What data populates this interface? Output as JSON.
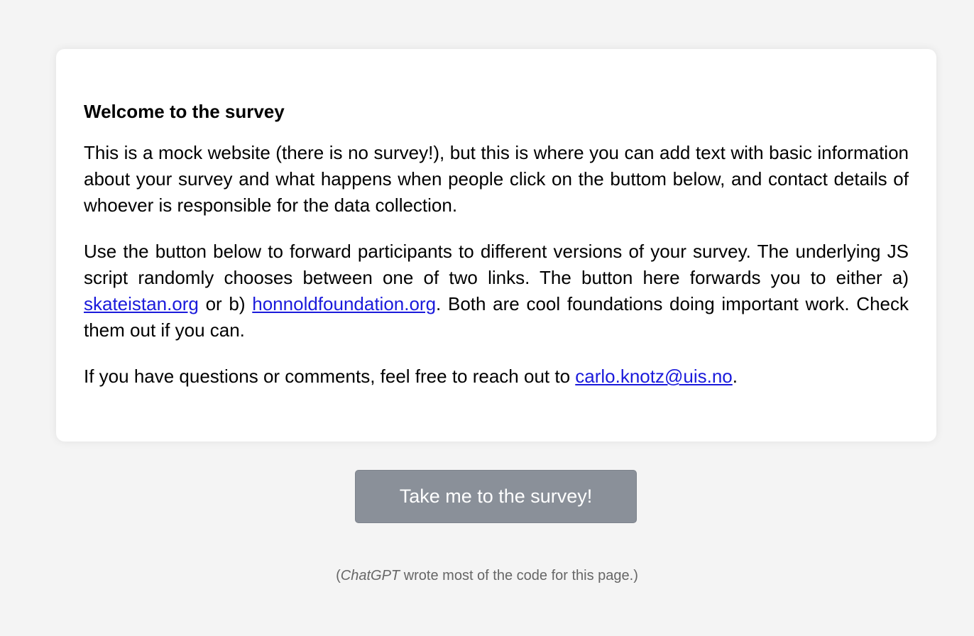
{
  "card": {
    "heading": "Welcome to the survey",
    "p1": "This is a mock website (there is no survey!), but this is where you can add text with basic information about your survey and what happens when people click on the buttom below, and contact details of whoever is responsible for the data collection.",
    "p2_a": "Use the button below to forward participants to different versions of your survey. The underlying JS script randomly chooses between one of two links. The button here forwards you to either a) ",
    "link1": "skateistan.org",
    "p2_b": " or b) ",
    "link2": "honnoldfoundation.org",
    "p2_c": ". Both are cool foundations doing important work. Check them out if you can.",
    "p3_a": "If you have questions or comments, feel free to reach out to ",
    "email": "carlo.knotz@uis.no",
    "p3_b": "."
  },
  "button": {
    "label": "Take me to the survey!"
  },
  "footer": {
    "open": "(",
    "italic": "ChatGPT",
    "rest": " wrote most of the code for this page.)"
  },
  "colors": {
    "button_bg": "#8a9099",
    "link": "#1a1adb",
    "page_bg": "#f4f4f4"
  }
}
